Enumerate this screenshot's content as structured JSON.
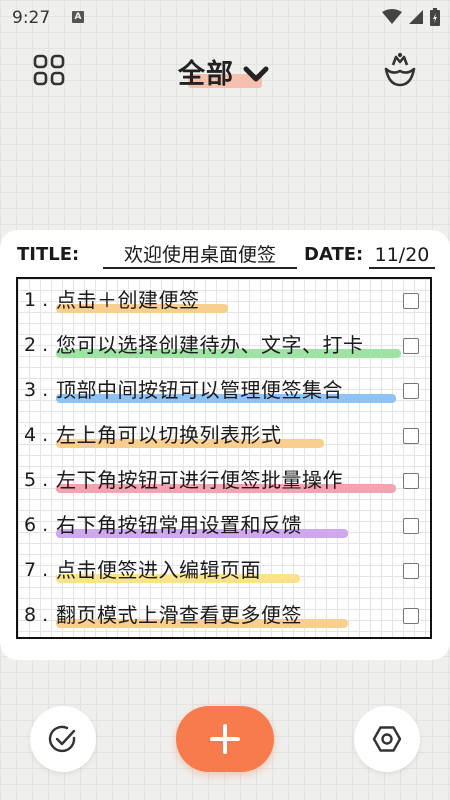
{
  "status_bar": {
    "time": "9:27",
    "notification_badge": "A"
  },
  "header": {
    "title": "全部"
  },
  "note": {
    "title_label": "TITLE:",
    "title_value": "欢迎使用桌面便签",
    "date_label": "DATE:",
    "date_value": "11/20",
    "items": [
      {
        "num": "1 .",
        "text": "点击＋创建便签",
        "highlight": "#f9cf8f",
        "checked": false
      },
      {
        "num": "2 .",
        "text": "您可以选择创建待办、文字、打卡",
        "highlight": "#9fe3a4",
        "checked": false
      },
      {
        "num": "3 .",
        "text": "顶部中间按钮可以管理便签集合",
        "highlight": "#8ec3f7",
        "checked": false
      },
      {
        "num": "4 .",
        "text": "左上角可以切换列表形式",
        "highlight": "#f9cf8f",
        "checked": false
      },
      {
        "num": "5 .",
        "text": "左下角按钮可进行便签批量操作",
        "highlight": "#f5a3b0",
        "checked": false
      },
      {
        "num": "6 .",
        "text": "右下角按钮常用设置和反馈",
        "highlight": "#cfa8ee",
        "checked": false
      },
      {
        "num": "7 .",
        "text": "点击便签进入编辑页面",
        "highlight": "#fbe38a",
        "checked": false
      },
      {
        "num": "8 .",
        "text": "翻页模式上滑查看更多便签",
        "highlight": "#f9cf8f",
        "checked": false
      }
    ]
  },
  "icons": {
    "grid": "grid-view-icon",
    "dropdown": "chevron-down-icon",
    "crown": "crown-icon",
    "batch": "check-circle-icon",
    "add": "plus-icon",
    "settings": "hexagon-settings-icon"
  },
  "colors": {
    "accent": "#f77b4d",
    "title_highlight": "#f6b9a2"
  }
}
